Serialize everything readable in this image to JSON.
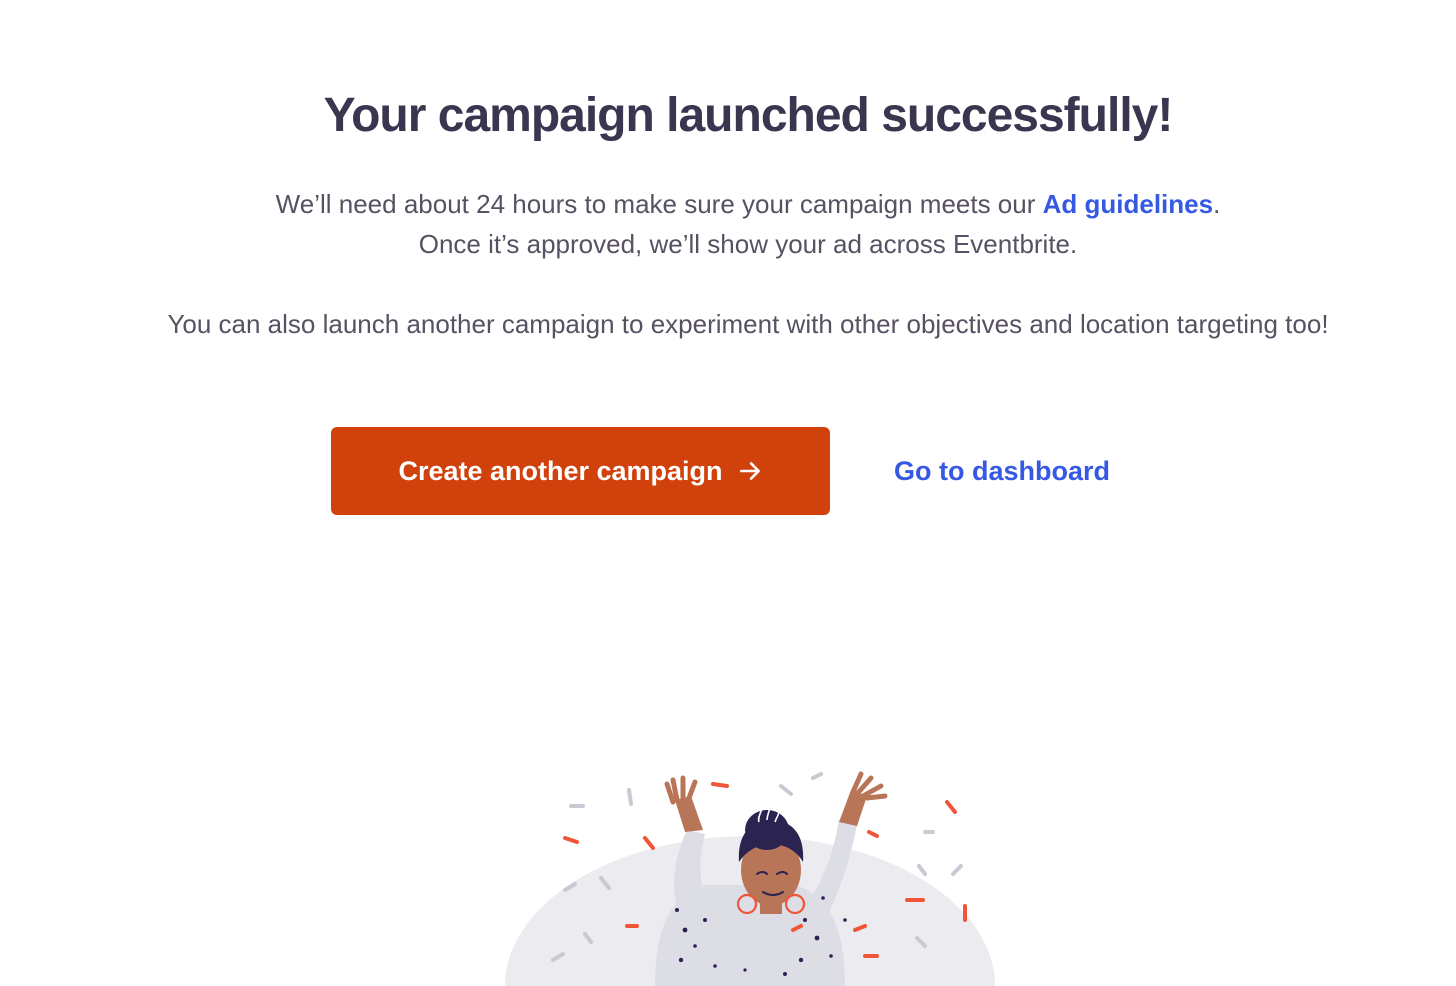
{
  "heading": "Your campaign launched successfully!",
  "description": {
    "line1_prefix": "We’ll need about 24 hours to make sure your campaign meets our ",
    "line1_link": "Ad guidelines",
    "line1_suffix": ".",
    "line2": "Once it’s approved, we’ll show your ad across Eventbrite.",
    "line3": "You can also launch another campaign to experiment with other objectives and location targeting too!"
  },
  "actions": {
    "create_label": "Create another campaign",
    "create_icon": "arrow-right-icon",
    "dashboard_label": "Go to dashboard"
  },
  "colors": {
    "primary_button": "#d1410c",
    "link": "#3659e3",
    "heading": "#39364f",
    "body_text": "#585163"
  },
  "illustration": {
    "icon": "celebrating-person-confetti-illustration"
  }
}
